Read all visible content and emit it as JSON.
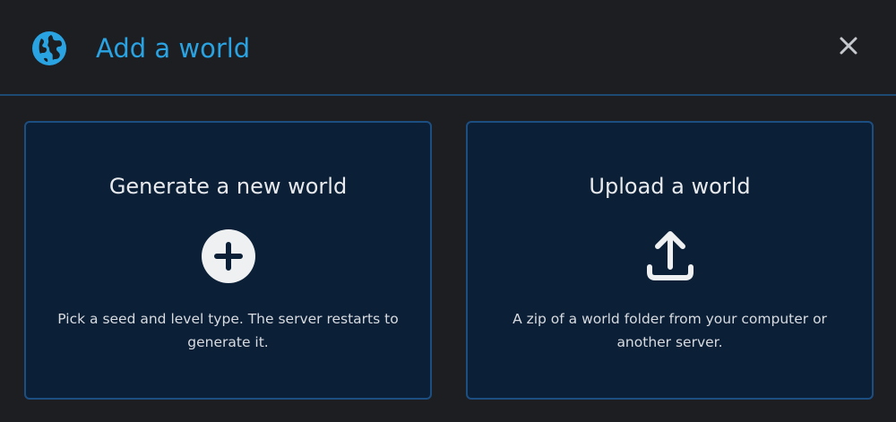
{
  "dialog": {
    "title": "Add a world",
    "title_icon": "globe-icon",
    "close_icon": "close-icon"
  },
  "options": [
    {
      "title": "Generate a new world",
      "icon": "plus-circle-icon",
      "description": "Pick a seed and level type. The server restarts to generate it."
    },
    {
      "title": "Upload a world",
      "icon": "upload-icon",
      "description": "A zip of a world folder from your computer or another server."
    }
  ],
  "colors": {
    "accent": "#2aa3e2",
    "card_background": "#0b1f37",
    "card_border": "#1d4e82",
    "background": "#1c1e22",
    "text": "#e8eaed"
  }
}
